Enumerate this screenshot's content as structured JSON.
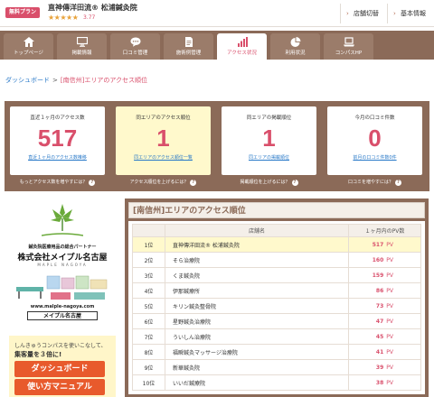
{
  "header": {
    "plan": "無料プラン",
    "shop_name": "直神傳洋田流® 松浦鍼灸院",
    "stars": "★★★★★",
    "rating": "3.77",
    "buttons": [
      {
        "label": "店舗切替"
      },
      {
        "label": "基本情報"
      }
    ]
  },
  "nav": {
    "tabs": [
      {
        "label": "トップページ",
        "icon": "home-icon"
      },
      {
        "label": "掲載情報",
        "icon": "monitor-icon"
      },
      {
        "label": "口コミ管理",
        "icon": "chat-icon"
      },
      {
        "label": "施術例管理",
        "icon": "document-icon"
      },
      {
        "label": "アクセス状況",
        "icon": "bar-chart-icon"
      },
      {
        "label": "利用状況",
        "icon": "pie-chart-icon"
      },
      {
        "label": "コンパスHP",
        "icon": "laptop-icon"
      }
    ],
    "active": "アクセス状況"
  },
  "breadcrumb": {
    "home": "ダッシュボード",
    "separator": ">",
    "current": "[南信州]エリアのアクセス順位"
  },
  "stats": {
    "cards": [
      {
        "title": "直近１ヶ月のアクセス数",
        "value": "517",
        "link": "直近１ヶ月のアクセス数推移"
      },
      {
        "title": "同エリアのアクセス順位",
        "value": "1",
        "link": "同エリアのアクセス順位一覧"
      },
      {
        "title": "同エリアの掲載順位",
        "value": "1",
        "link": "同エリアの掲載順位"
      },
      {
        "title": "今月の口コミ件数",
        "value": "0",
        "link": "前月の口コミ件数0件"
      }
    ],
    "footers": [
      {
        "label": "もっとアクセス数を増やすには？"
      },
      {
        "label": "アクセス順位を上げるには？"
      },
      {
        "label": "掲載順位を上げるには？"
      },
      {
        "label": "口コミを増やすには？"
      }
    ],
    "footer_help": "?"
  },
  "ads": {
    "maple": {
      "partner": "鍼灸院医療用品の総合パートナー",
      "company": "株式会社メイプル名古屋",
      "roman": "MAPLE NAGOYA",
      "url": "www.malple-nagoya.com",
      "store": "メイプル名古屋"
    },
    "compass": {
      "line1": "しんきゅうコンパスを使いこなして、",
      "line2": "集客量を３倍に!",
      "line3": "ダッシュボード",
      "line4": "使い方マニュアル"
    }
  },
  "ranking": {
    "title": "[南信州]エリアのアクセス順位",
    "columns": [
      "",
      "店舗名",
      "１ヶ月内のPV数"
    ],
    "unit": "PV",
    "rows": [
      {
        "rank": "1位",
        "name": "直神傳洋田流® 松浦鍼灸院",
        "pv": "517",
        "own": true
      },
      {
        "rank": "2位",
        "name": "そら治療院",
        "pv": "160"
      },
      {
        "rank": "3位",
        "name": "くま鍼灸院",
        "pv": "159"
      },
      {
        "rank": "4位",
        "name": "伊那鍼療所",
        "pv": "86"
      },
      {
        "rank": "5位",
        "name": "キリン鍼灸整骨院",
        "pv": "73"
      },
      {
        "rank": "6位",
        "name": "星野鍼灸治療院",
        "pv": "47"
      },
      {
        "rank": "7位",
        "name": "ういしん治療院",
        "pv": "45"
      },
      {
        "rank": "8位",
        "name": "福瞬鍼灸マッサージ治療院",
        "pv": "41"
      },
      {
        "rank": "9位",
        "name": "新華鍼灸院",
        "pv": "39"
      },
      {
        "rank": "10位",
        "name": "いいだ鍼療院",
        "pv": "38"
      }
    ]
  },
  "colors": {
    "accent": "#d94f6b",
    "brown": "#8b6a58",
    "link": "#2979c8",
    "highlight": "#fff9cc"
  }
}
